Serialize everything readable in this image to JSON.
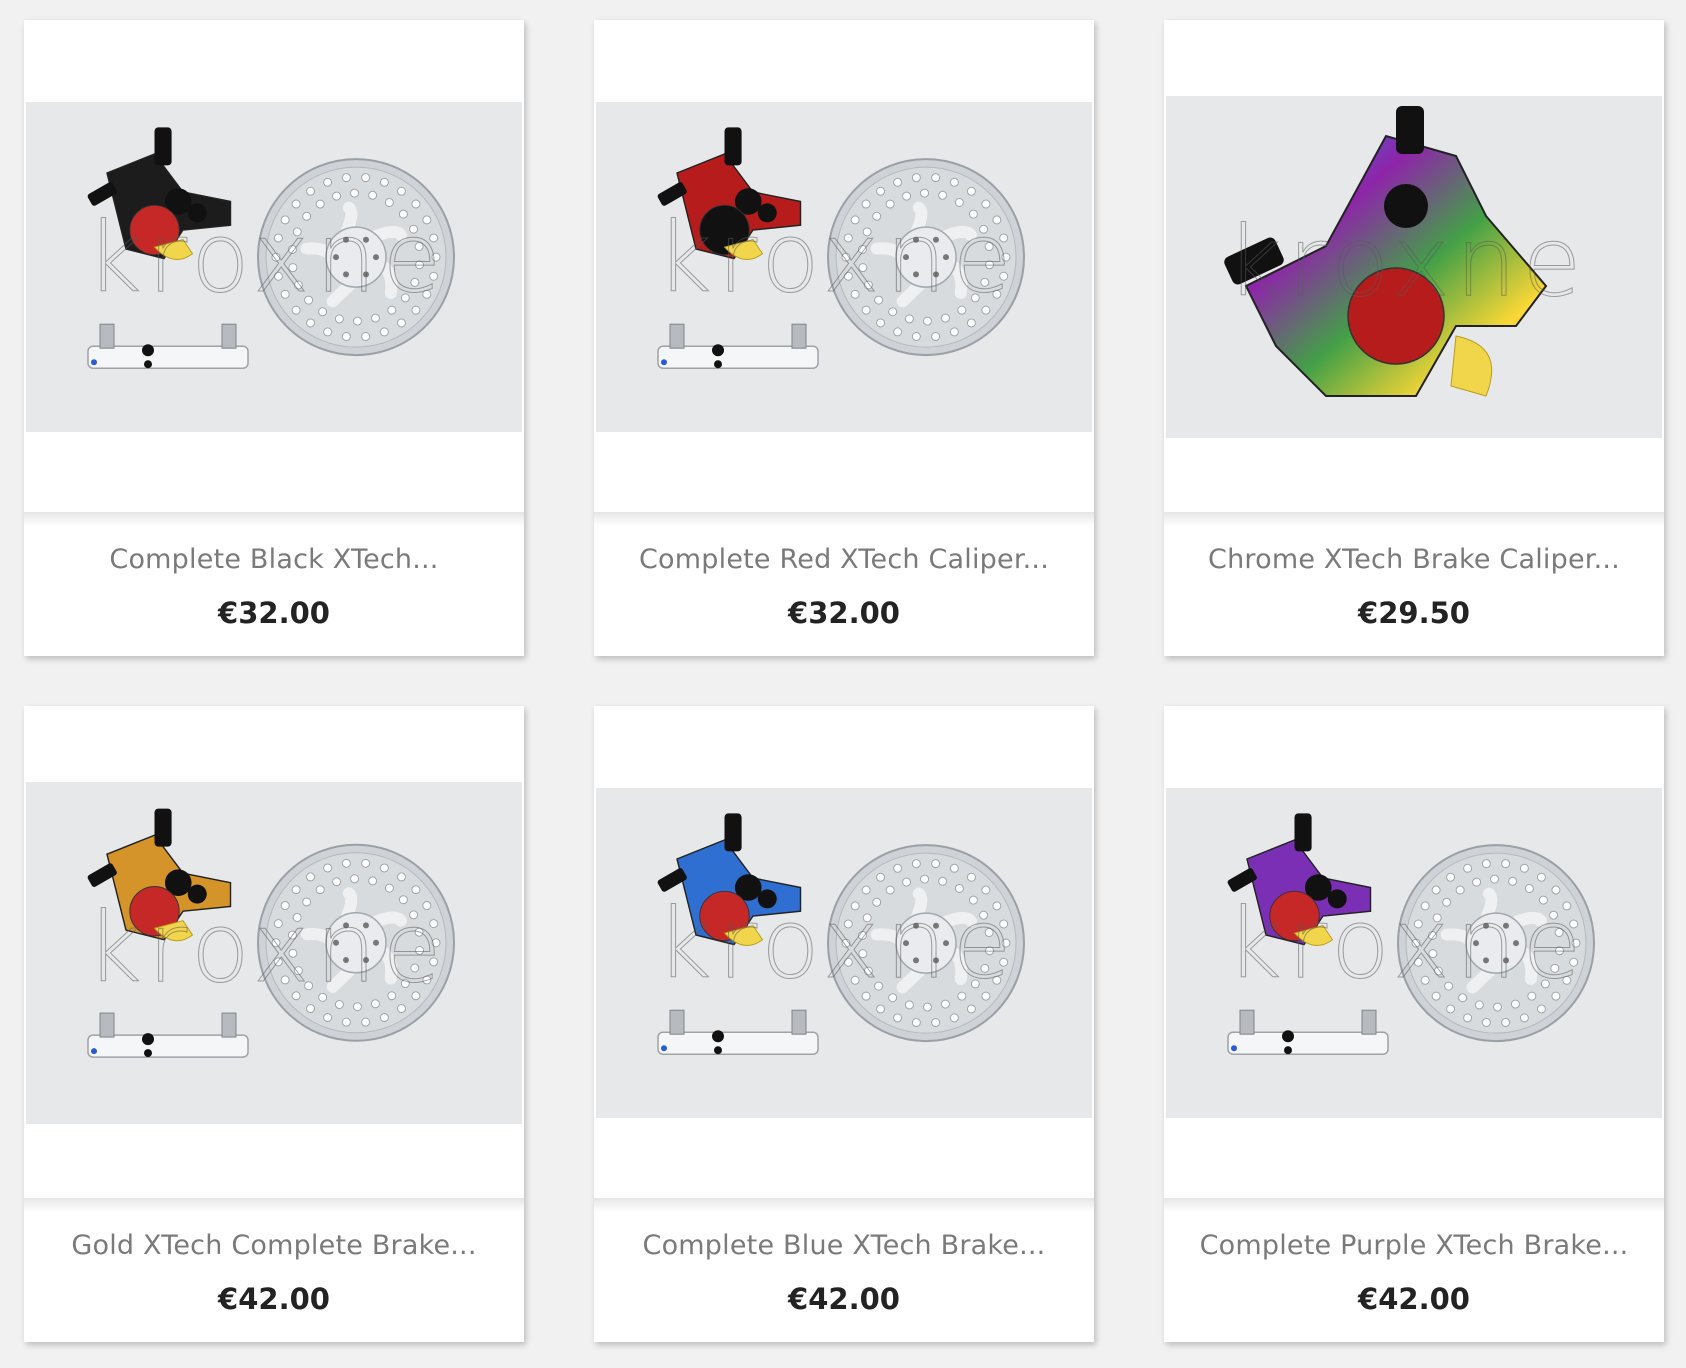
{
  "products": [
    {
      "title": "Complete Black XTech...",
      "price": "€32.00",
      "color": "#1c1c1c",
      "accent": "#c62828",
      "kind": "kit"
    },
    {
      "title": "Complete Red XTech Caliper...",
      "price": "€32.00",
      "color": "#b71c1c",
      "accent": "#111111",
      "kind": "kit"
    },
    {
      "title": "Chrome XTech Brake Caliper...",
      "price": "€29.50",
      "color": "#6a1b9a",
      "accent": "#b71c1c",
      "kind": "caliper"
    },
    {
      "title": "Gold XTech Complete Brake...",
      "price": "€42.00",
      "color": "#d4942a",
      "accent": "#c62828",
      "kind": "kit"
    },
    {
      "title": "Complete Blue XTech Brake...",
      "price": "€42.00",
      "color": "#2f6fd1",
      "accent": "#c62828",
      "kind": "kit"
    },
    {
      "title": "Complete Purple XTech Brake...",
      "price": "€42.00",
      "color": "#7b2fb5",
      "accent": "#c62828",
      "kind": "kit"
    }
  ],
  "watermark": "kroxne"
}
